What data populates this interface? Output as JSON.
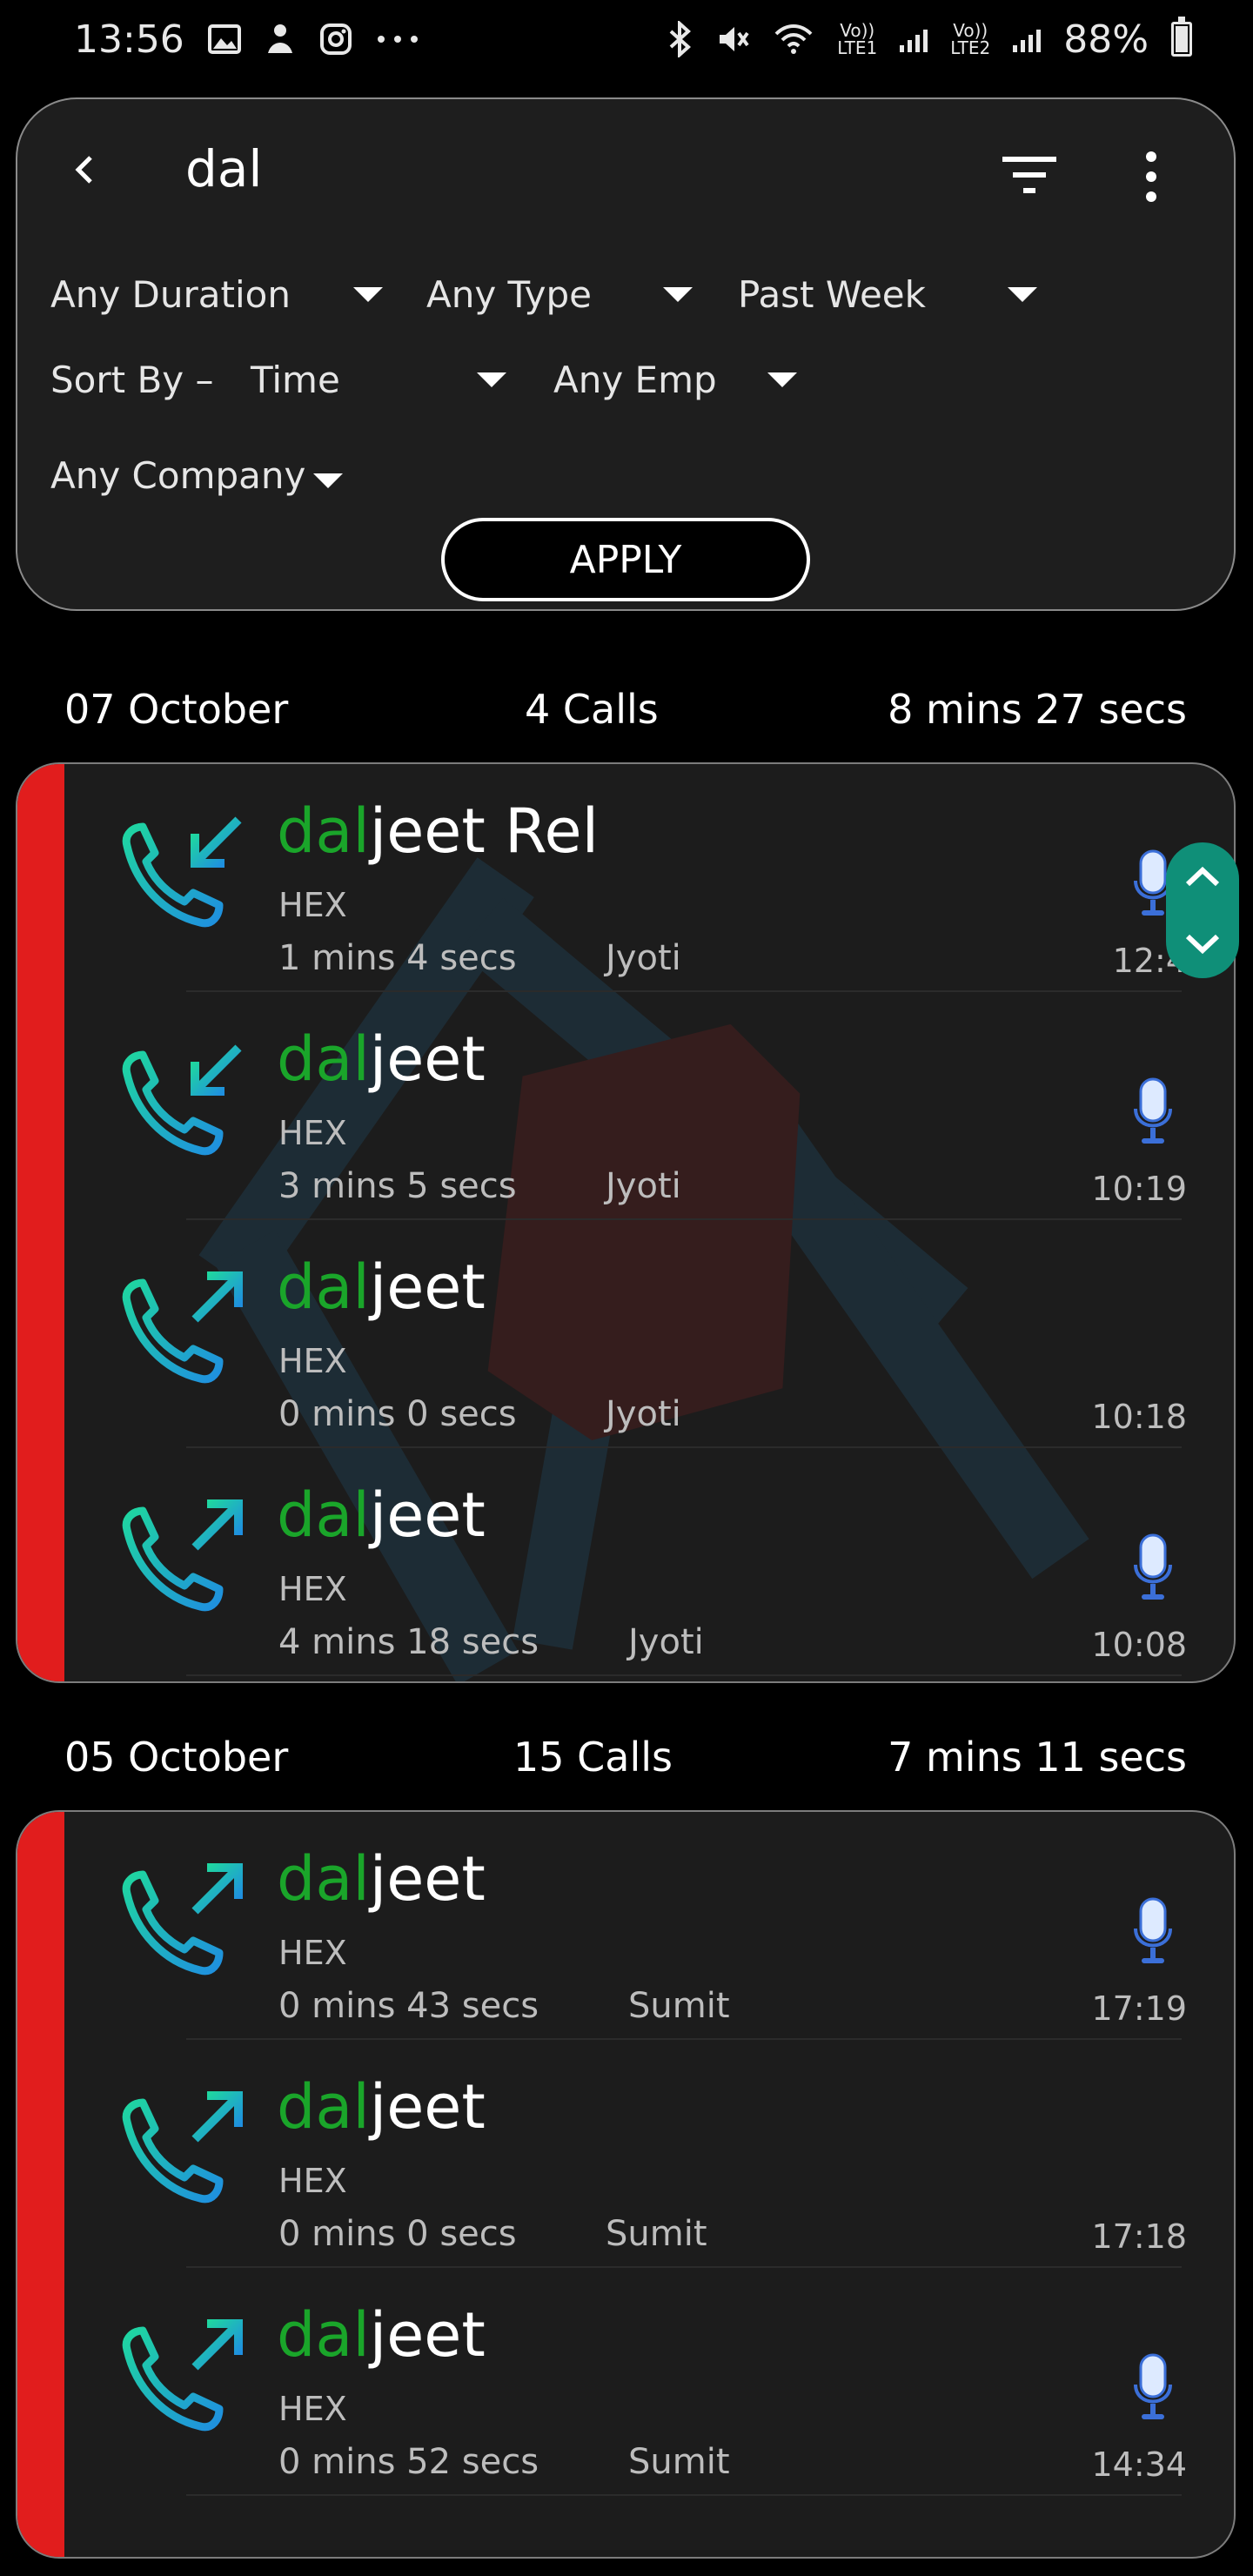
{
  "status_bar": {
    "time": "13:56",
    "sim1_label": "LTE1",
    "sim2_label": "LTE2",
    "volte": "Vo))",
    "battery": "88%",
    "battery_level": 0.88,
    "left_icons": [
      "gallery-icon",
      "notification-icon",
      "instagram-icon",
      "more-dots-icon"
    ],
    "right_icons": [
      "bluetooth-icon",
      "mute-icon",
      "wifi-icon",
      "signal-icon",
      "signal-icon",
      "battery-icon"
    ]
  },
  "search": {
    "query": "dal",
    "filters": {
      "duration": "Any Duration",
      "type": "Any Type",
      "period": "Past Week",
      "sort_prefix": "Sort By –",
      "sort_value": "Time",
      "employee": "Any Emp",
      "company": "Any Company"
    },
    "apply_label": "APPLY"
  },
  "groups": [
    {
      "date": "07 October",
      "count": "4 Calls",
      "total": "8 mins 27 secs",
      "calls": [
        {
          "match": "dal",
          "rest": "jeet Rel",
          "direction": "incoming",
          "company": "HEX",
          "duration": "1 mins 4 secs",
          "employee": "Jyoti",
          "time": "12:4",
          "recording": true
        },
        {
          "match": "dal",
          "rest": "jeet",
          "direction": "incoming",
          "company": "HEX",
          "duration": "3 mins 5 secs",
          "employee": "Jyoti",
          "time": "10:19",
          "recording": true
        },
        {
          "match": "dal",
          "rest": "jeet",
          "direction": "outgoing",
          "company": "HEX",
          "duration": "0 mins 0 secs",
          "employee": "Jyoti",
          "time": "10:18",
          "recording": false
        },
        {
          "match": "dal",
          "rest": "jeet",
          "direction": "outgoing",
          "company": "HEX",
          "duration": "4 mins 18 secs",
          "employee": "Jyoti",
          "time": "10:08",
          "recording": true
        }
      ]
    },
    {
      "date": "05 October",
      "count": "15 Calls",
      "total": "7 mins 11 secs",
      "calls": [
        {
          "match": "dal",
          "rest": "jeet",
          "direction": "outgoing",
          "company": "HEX",
          "duration": "0 mins 43 secs",
          "employee": "Sumit",
          "time": "17:19",
          "recording": true
        },
        {
          "match": "dal",
          "rest": "jeet",
          "direction": "outgoing",
          "company": "HEX",
          "duration": "0 mins 0 secs",
          "employee": "Sumit",
          "time": "17:18",
          "recording": false
        },
        {
          "match": "dal",
          "rest": "jeet",
          "direction": "outgoing",
          "company": "HEX",
          "duration": "0 mins 52 secs",
          "employee": "Sumit",
          "time": "14:34",
          "recording": true
        }
      ]
    }
  ],
  "colors": {
    "match_highlight": "#1aa52a",
    "stripe": "#e11d1d",
    "scroll_button": "#0f8f78",
    "icon_gradient_top": "#1fd6a0",
    "icon_gradient_bottom": "#1f8fe0"
  }
}
